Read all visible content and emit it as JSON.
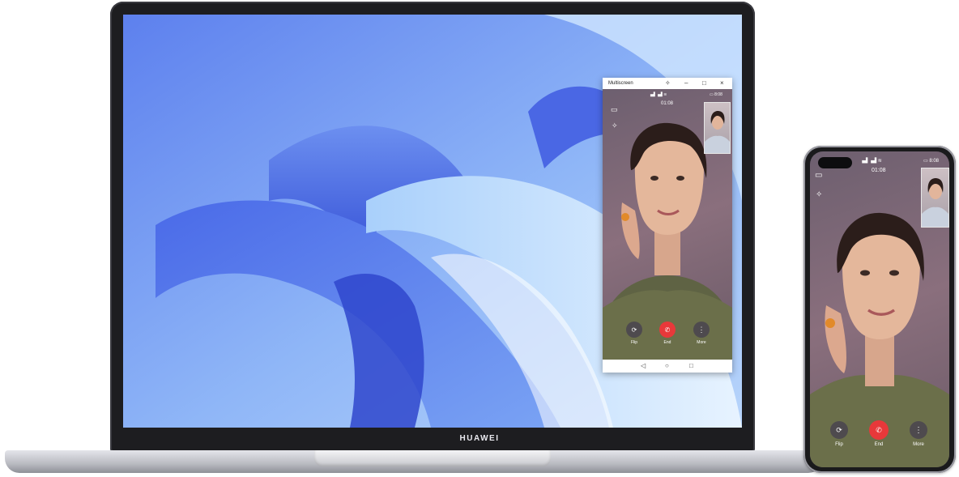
{
  "laptop": {
    "brand": "HUAWEI"
  },
  "multiscreen": {
    "title": "Multiscreen",
    "controls": {
      "pin": "✧",
      "minimize": "–",
      "maximize": "□",
      "close": "×"
    },
    "status": {
      "signal": "▗▟ ▗▟ ≋",
      "battery_time": "▭ 8:08"
    },
    "call_duration": "01:08",
    "buttons": {
      "flip": "Flip",
      "end": "End",
      "more": "More"
    },
    "nav": {
      "back": "◁",
      "home": "○",
      "recent": "□"
    }
  },
  "phone": {
    "status": {
      "signal": "▗▟ ▗▟ ≋",
      "battery_time": "▭ 8:08"
    },
    "call_duration": "01:08",
    "buttons": {
      "flip": "Flip",
      "end": "End",
      "more": "More"
    }
  },
  "colors": {
    "end_call": "#e8383a",
    "control_button": "#4e4a4e"
  }
}
